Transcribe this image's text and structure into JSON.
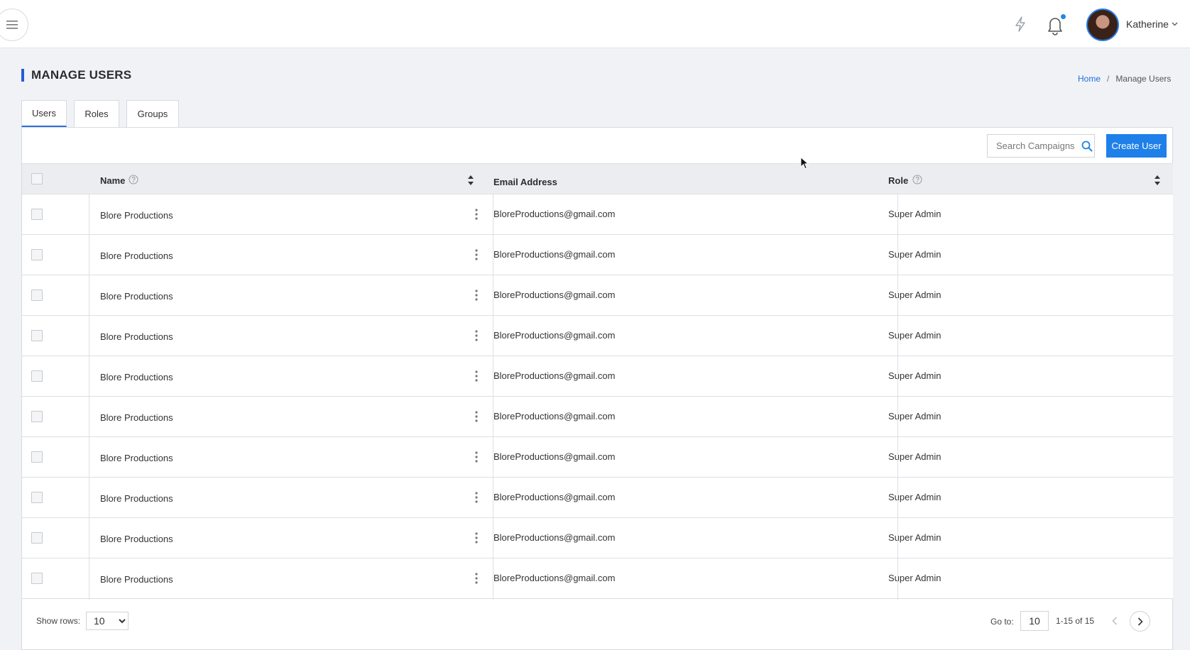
{
  "header": {
    "user_name": "Katherine",
    "icons": [
      "hamburger-menu-icon",
      "bolt-icon",
      "bell-icon",
      "avatar",
      "chevron-down-icon"
    ],
    "accent_color": "#1e88e5"
  },
  "page": {
    "title": "MANAGE USERS",
    "breadcrumb": {
      "home": "Home",
      "separator": "/",
      "current": "Manage Users"
    }
  },
  "tabs": [
    {
      "label": "Users",
      "active": true
    },
    {
      "label": "Roles",
      "active": false
    },
    {
      "label": "Groups",
      "active": false
    }
  ],
  "toolbar": {
    "search_placeholder": "Search Campaigns",
    "create_label": "Create User",
    "create_color": "#1e80e8"
  },
  "table": {
    "columns": {
      "name": "Name",
      "email": "Email Address",
      "role": "Role"
    },
    "rows": [
      {
        "name": "Blore Productions",
        "email": "BloreProductions@gmail.com",
        "role": "Super Admin"
      },
      {
        "name": "Blore Productions",
        "email": "BloreProductions@gmail.com",
        "role": "Super Admin"
      },
      {
        "name": "Blore Productions",
        "email": "BloreProductions@gmail.com",
        "role": "Super Admin"
      },
      {
        "name": "Blore Productions",
        "email": "BloreProductions@gmail.com",
        "role": "Super Admin"
      },
      {
        "name": "Blore Productions",
        "email": "BloreProductions@gmail.com",
        "role": "Super Admin"
      },
      {
        "name": "Blore Productions",
        "email": "BloreProductions@gmail.com",
        "role": "Super Admin"
      },
      {
        "name": "Blore Productions",
        "email": "BloreProductions@gmail.com",
        "role": "Super Admin"
      },
      {
        "name": "Blore Productions",
        "email": "BloreProductions@gmail.com",
        "role": "Super Admin"
      },
      {
        "name": "Blore Productions",
        "email": "BloreProductions@gmail.com",
        "role": "Super Admin"
      },
      {
        "name": "Blore Productions",
        "email": "BloreProductions@gmail.com",
        "role": "Super Admin"
      }
    ]
  },
  "footer": {
    "show_rows_label": "Show rows:",
    "rows_options": [
      "10"
    ],
    "rows_selected": "10",
    "goto_label": "Go to:",
    "goto_value": "10",
    "range": "1-15 of 15"
  }
}
